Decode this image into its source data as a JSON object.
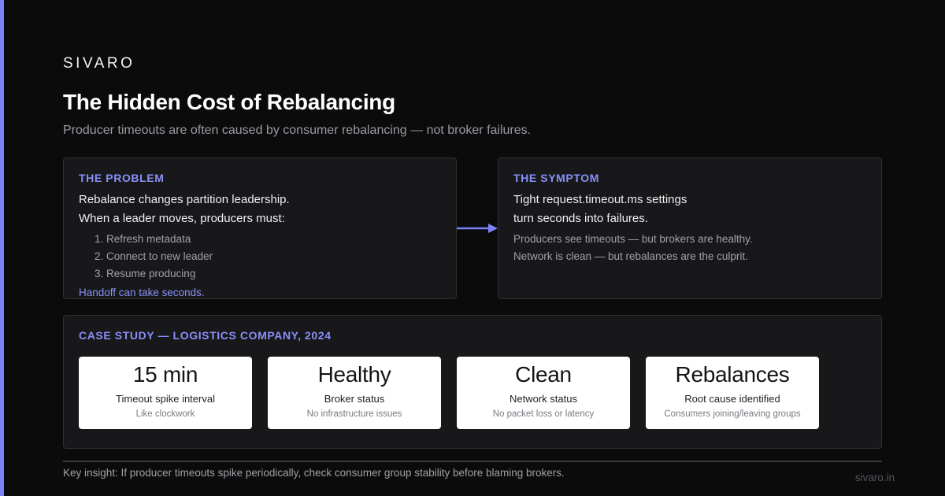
{
  "brand": "SIVARO",
  "title": "The Hidden Cost of Rebalancing",
  "subtitle": "Producer timeouts are often caused by consumer rebalancing — not broker failures.",
  "problem": {
    "heading": "THE PROBLEM",
    "line1": "Rebalance changes partition leadership.",
    "line2": "When a leader moves, producers must:",
    "steps": [
      "1. Refresh metadata",
      "2. Connect to new leader",
      "3. Resume producing"
    ],
    "note": "Handoff can take seconds."
  },
  "symptom": {
    "heading": "THE SYMPTOM",
    "line1": "Tight request.timeout.ms settings",
    "line2": "turn seconds into failures.",
    "detail1": "Producers see timeouts — but brokers are healthy.",
    "detail2": "Network is clean — but rebalances are the culprit."
  },
  "case_study": {
    "heading": "CASE STUDY — LOGISTICS COMPANY, 2024",
    "stats": [
      {
        "value": "15 min",
        "label": "Timeout spike interval",
        "desc": "Like clockwork"
      },
      {
        "value": "Healthy",
        "label": "Broker status",
        "desc": "No infrastructure issues"
      },
      {
        "value": "Clean",
        "label": "Network status",
        "desc": "No packet loss or latency"
      },
      {
        "value": "Rebalances",
        "label": "Root cause identified",
        "desc": "Consumers joining/leaving groups"
      }
    ]
  },
  "insight": "Key insight: If producer timeouts spike periodically, check consumer group stability before blaming brokers.",
  "footer_url": "sivaro.in",
  "colors": {
    "background": "#0b0b0c",
    "accent": "#7b82f7",
    "card": "#18181b",
    "card_border": "#2f2f35"
  },
  "icons": {
    "arrow": "arrow-right-icon"
  }
}
